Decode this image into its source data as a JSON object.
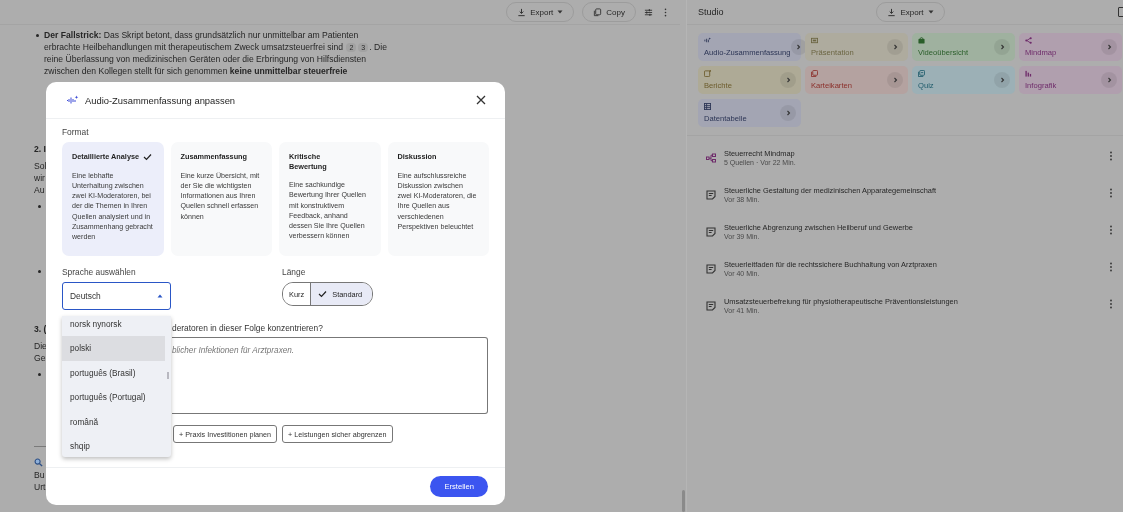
{
  "doc_toolbar": {
    "export": "Export",
    "copy": "Copy"
  },
  "document": {
    "paragraph": {
      "before": "**Der Fallstrick:** Das Skript betont, dass grundsätzlich nur unmittelbar am Patienten erbrachte Heilbehandlungen mit therapeutischem Zweck umsatzsteuerfrei sind",
      "citations": [
        "2",
        "3"
      ],
      "after": ". Die reine Überlassung von medizinischen Geräten oder die Erbringung von Hilfsdiensten zwischen den Kollegen stellt für sich genommen **keine unmittelbar steuerfreie**"
    },
    "fragments": [
      {
        "kind": "heading",
        "text": "2. I"
      },
      {
        "kind": "text",
        "text": "Sol"
      },
      {
        "kind": "text",
        "text": "wir"
      },
      {
        "kind": "text",
        "text": "Au"
      },
      {
        "kind": "bullet"
      },
      {
        "kind": "bullet"
      },
      {
        "kind": "heading",
        "text": "3. ("
      },
      {
        "kind": "text",
        "text": "Die"
      },
      {
        "kind": "text",
        "text": "Ge"
      },
      {
        "kind": "bullet"
      },
      {
        "kind": "rule"
      },
      {
        "kind": "search"
      },
      {
        "kind": "text",
        "text": "Bu"
      },
      {
        "kind": "text",
        "text": "Urt"
      }
    ]
  },
  "studio": {
    "title": "Studio",
    "export": "Export",
    "tools": [
      {
        "label": "Audio-Zusammenfassung",
        "kind": "audio",
        "color": "#a3a5b3"
      },
      {
        "label": "Präsentation",
        "kind": "slides",
        "color": "#aeab9e"
      },
      {
        "label": "Videoübersicht",
        "kind": "video",
        "color": "#9fb19f"
      },
      {
        "label": "Mindmap",
        "kind": "mindmap",
        "color": "#b09fae"
      },
      {
        "label": "Berichte",
        "kind": "report",
        "color": "#aeaa96"
      },
      {
        "label": "Karteikarten",
        "kind": "cards",
        "color": "#b4a2a0"
      },
      {
        "label": "Quiz",
        "kind": "quiz",
        "color": "#9cb0b6"
      },
      {
        "label": "Infografik",
        "kind": "infographic",
        "color": "#b09fae"
      },
      {
        "label": "Datentabelle",
        "kind": "table",
        "color": "#a3a5b3"
      }
    ],
    "notes": [
      {
        "kind": "mindmap",
        "title": "Steuerrecht Mindmap",
        "meta": "5 Quellen · Vor 22 Min."
      },
      {
        "kind": "note",
        "title": "Steuerliche Gestaltung der medizinischen Apparategemeinschaft",
        "meta": "Vor 38 Min."
      },
      {
        "kind": "note",
        "title": "Steuerliche Abgrenzung zwischen Heilberuf und Gewerbe",
        "meta": "Vor 39 Min."
      },
      {
        "kind": "note",
        "title": "Steuerleitfaden für die rechtssichere Buchhaltung von Arztpraxen",
        "meta": "Vor 40 Min."
      },
      {
        "kind": "note",
        "title": "Umsatzsteuerbefreiung für physiotherapeutische Präventionsleistungen",
        "meta": "Vor 41 Min."
      }
    ]
  },
  "dialog": {
    "title": "Audio-Zusammenfassung anpassen",
    "format_label": "Format",
    "formats": [
      {
        "title": "Detaillierte Analyse",
        "description": "Eine lebhafte Unterhaltung zwischen zwei KI-Moderatoren, bei der die Themen in Ihren Quellen analysiert und in Zusammenhang gebracht werden",
        "selected": true
      },
      {
        "title": "Zusammenfassung",
        "description": "Eine kurze Übersicht, mit der Sie die wichtigsten Informationen aus Ihren Quellen schnell erfassen können",
        "selected": false
      },
      {
        "title": "Kritische Bewertung",
        "description": "Eine sachkundige Bewertung Ihrer Quellen mit konstruktivem Feedback, anhand dessen Sie Ihre Quellen verbessern können",
        "selected": false
      },
      {
        "title": "Diskussion",
        "description": "Eine aufschlussreiche Diskussion zwischen zwei KI-Moderatoren, die Ihre Quellen aus verschiedenen Perspektiven beleuchtet",
        "selected": false
      }
    ],
    "language_label": "Sprache auswählen",
    "language": {
      "value": "Deutsch",
      "expanded": true,
      "options": [
        {
          "label": "norsk nynorsk",
          "highlighted": false
        },
        {
          "label": "polski",
          "highlighted": true
        },
        {
          "label": "português (Brasil)",
          "highlighted": false
        },
        {
          "label": "português (Portugal)",
          "highlighted": false
        },
        {
          "label": "română",
          "highlighted": false
        },
        {
          "label": "shqip",
          "highlighted": false
        }
      ]
    },
    "length_label": "Länge",
    "lengths": [
      {
        "label": "Kurz",
        "selected": false
      },
      {
        "label": "Standard",
        "selected": true
      }
    ],
    "focus_question": "deratoren in dieser Folge konzentrieren?",
    "focus_field": {
      "placeholder": "blicher Infektionen für Arztpraxen."
    },
    "suggestions": [
      "+ Praxis Investitionen planen",
      "+ Leistungen sicher abgrenzen"
    ],
    "submit": "Erstellen"
  }
}
